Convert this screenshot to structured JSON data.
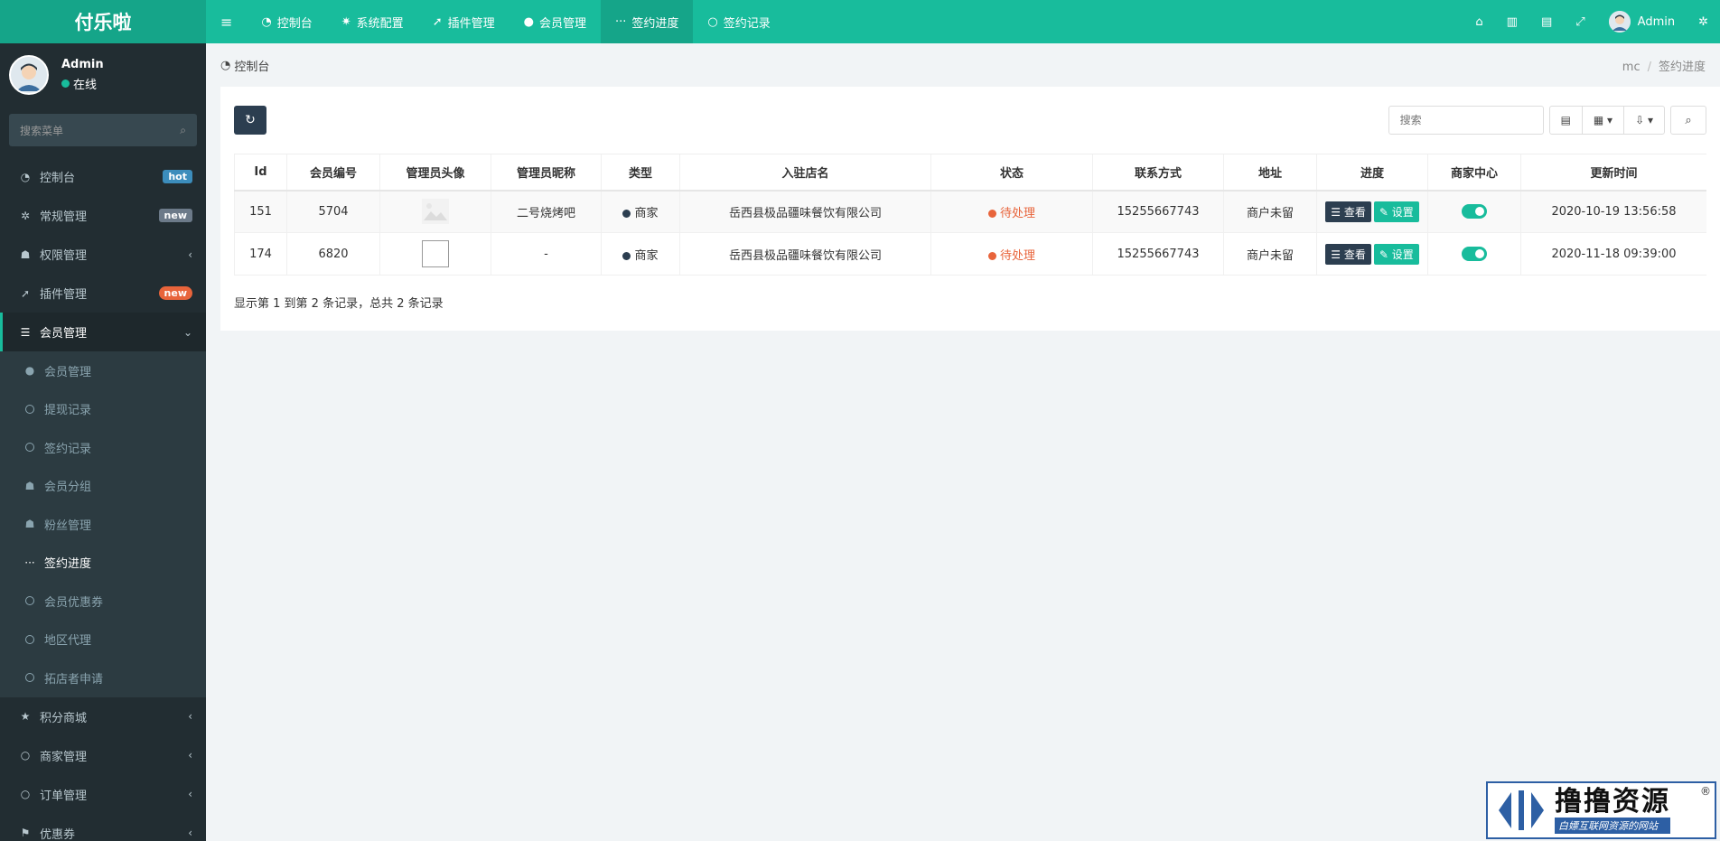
{
  "app": {
    "logo": "付乐啦"
  },
  "topnav": {
    "items": [
      {
        "label": "控制台",
        "icon": "dashboard-icon"
      },
      {
        "label": "系统配置",
        "icon": "gear-icon"
      },
      {
        "label": "插件管理",
        "icon": "rocket-icon"
      },
      {
        "label": "会员管理",
        "icon": "user-icon"
      },
      {
        "label": "签约进度",
        "icon": "ellipsis-icon",
        "active": true
      },
      {
        "label": "签约记录",
        "icon": "circle-icon"
      }
    ],
    "user": "Admin"
  },
  "sidebar": {
    "user": {
      "name": "Admin",
      "status": "在线"
    },
    "search_placeholder": "搜索菜单",
    "items": [
      {
        "label": "控制台",
        "badge": "hot"
      },
      {
        "label": "常规管理",
        "badge": "new"
      },
      {
        "label": "权限管理"
      },
      {
        "label": "插件管理",
        "badge": "new"
      },
      {
        "label": "会员管理",
        "open": true
      },
      {
        "label": "积分商城"
      },
      {
        "label": "商家管理"
      },
      {
        "label": "订单管理"
      },
      {
        "label": "优惠券"
      }
    ],
    "subitems": [
      {
        "label": "会员管理"
      },
      {
        "label": "提现记录"
      },
      {
        "label": "签约记录"
      },
      {
        "label": "会员分组"
      },
      {
        "label": "粉丝管理"
      },
      {
        "label": "签约进度",
        "active": true
      },
      {
        "label": "会员优惠券"
      },
      {
        "label": "地区代理"
      },
      {
        "label": "拓店者申请"
      }
    ]
  },
  "breadcrumb": {
    "left": "控制台",
    "right": [
      "mc",
      "签约进度"
    ]
  },
  "toolbar": {
    "search_placeholder": "搜索"
  },
  "table": {
    "headers": [
      "Id",
      "会员编号",
      "管理员头像",
      "管理员昵称",
      "类型",
      "入驻店名",
      "状态",
      "联系方式",
      "地址",
      "进度",
      "商家中心",
      "更新时间"
    ],
    "rows": [
      {
        "id": "151",
        "member_no": "5704",
        "nickname": "二号烧烤吧",
        "type": "商家",
        "shop": "岳西县极品疆味餐饮有限公司",
        "status": "待处理",
        "phone": "15255667743",
        "address": "商户未留",
        "view": "查看",
        "set": "设置",
        "merchant_center": true,
        "updated": "2020-10-19 13:56:58"
      },
      {
        "id": "174",
        "member_no": "6820",
        "nickname": "-",
        "type": "商家",
        "shop": "岳西县极品疆味餐饮有限公司",
        "status": "待处理",
        "phone": "15255667743",
        "address": "商户未留",
        "view": "查看",
        "set": "设置",
        "merchant_center": true,
        "updated": "2020-11-18 09:39:00"
      }
    ]
  },
  "pagination": {
    "info": "显示第 1 到第 2 条记录，总共 2 条记录"
  },
  "watermark": {
    "title": "撸撸资源",
    "subtitle": "白嫖互联网资源的网站",
    "reg": "®"
  },
  "colors": {
    "primary": "#18bc9c",
    "sidebar": "#222d32",
    "dark": "#2c3e50",
    "orange": "#e8643b"
  }
}
